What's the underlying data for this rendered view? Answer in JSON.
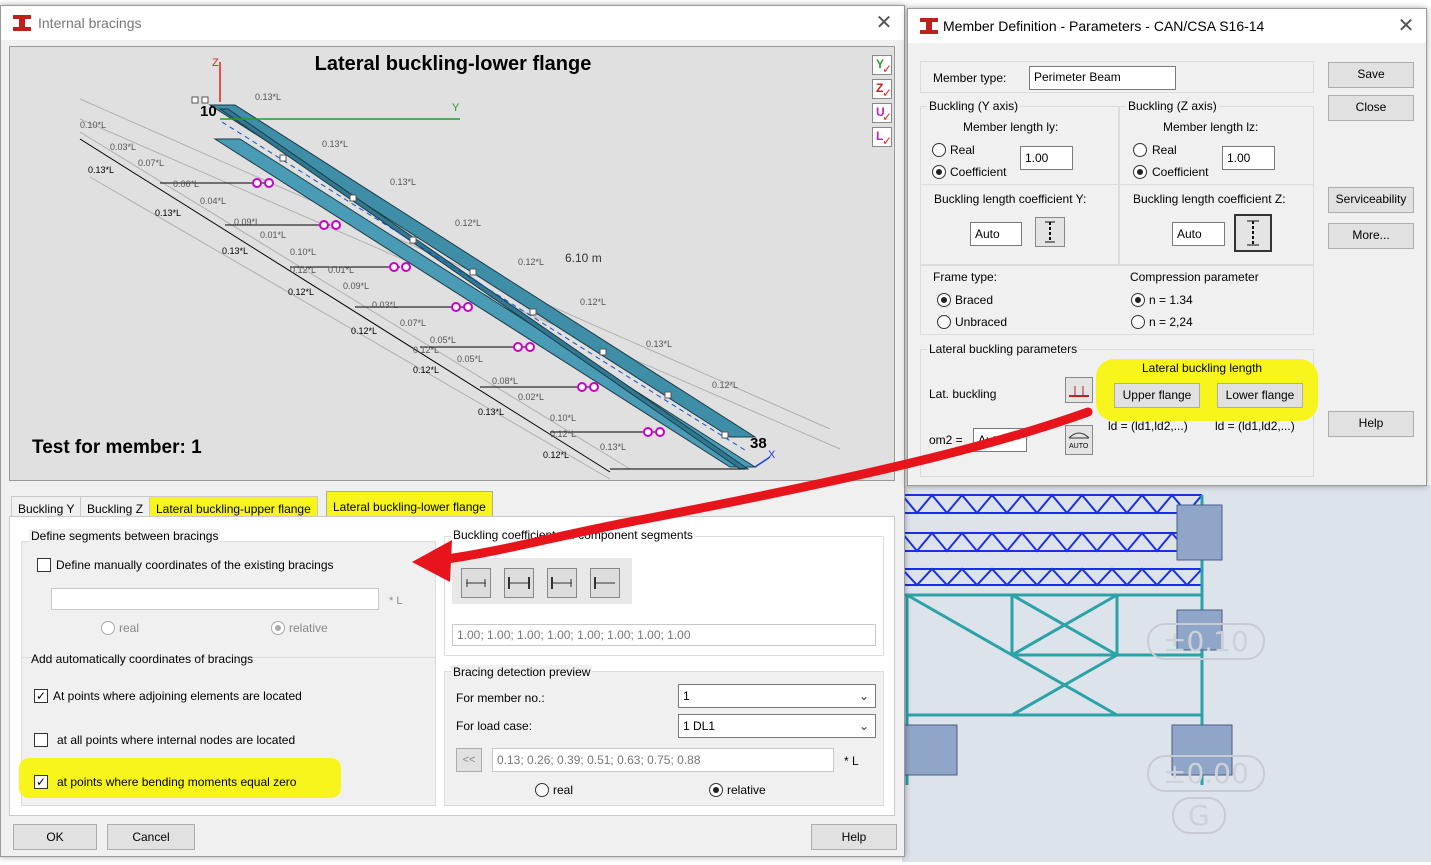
{
  "internal_bracings": {
    "title": "Internal bracings",
    "preview": {
      "title": "Lateral buckling-lower flange",
      "footer": "Test for member: 1",
      "span": "6.10  m",
      "node_start": "10",
      "node_end": "38",
      "axis_z": "Z",
      "axis_y": "Y",
      "axis_x": "X",
      "dim_labels": [
        "0.13*L",
        "0.10*L",
        "0.13*L",
        "0.03*L",
        "0.07*L",
        "0.13*L",
        "0.06*L",
        "0.13*L",
        "0.04*L",
        "0.13*L",
        "0.09*L",
        "0.12*L",
        "0.01*L",
        "0.13*L",
        "0.10*L",
        "0.12*L",
        "0.12*L",
        "0.01*L",
        "0.12*L",
        "0.09*L",
        "0.12*L",
        "0.03*L",
        "0.12*L",
        "0.07*L",
        "0.13*L",
        "0.05*L",
        "0.12*L",
        "0.05*L",
        "0.12*L",
        "0.08*L",
        "0.12*L",
        "0.02*L",
        "0.13*L",
        "0.10*L",
        "0.12*L",
        "0.13*L",
        "0.12*L"
      ],
      "side_icons": [
        "Y",
        "Z",
        "U",
        "L"
      ]
    },
    "tabs": [
      "Buckling Y",
      "Buckling Z",
      "Lateral buckling-upper flange",
      "Lateral buckling-lower flange"
    ],
    "define_segments": {
      "title": "Define segments between bracings",
      "manual_label": "Define manually coordinates of the existing bracings",
      "manual_checked": false,
      "unit": "* L",
      "real": "real",
      "relative": "relative"
    },
    "add_auto": {
      "title": "Add automatically coordinates of bracings",
      "opt1": "At points where adjoining elements are located",
      "opt1_checked": true,
      "opt2": "at all points where internal nodes are located",
      "opt2_checked": false,
      "opt3": "at points where bending moments equal zero",
      "opt3_checked": true
    },
    "buckling_coeff": {
      "title": "Buckling coefficients of component segments",
      "values": "1.00; 1.00; 1.00; 1.00; 1.00; 1.00; 1.00; 1.00"
    },
    "detection": {
      "title": "Bracing detection preview",
      "member_label": "For member no.:",
      "member_value": "1",
      "load_label": "For load case:",
      "load_value": "1  DL1",
      "back": "<<",
      "coords": "0.13; 0.26; 0.39; 0.51; 0.63; 0.75; 0.88",
      "unit": "* L",
      "real": "real",
      "relative": "relative"
    },
    "buttons": {
      "ok": "OK",
      "cancel": "Cancel",
      "help": "Help"
    }
  },
  "member_definition": {
    "title": "Member Definition - Parameters - CAN/CSA S16-14",
    "member_type_label": "Member type:",
    "member_type_value": "Perimeter Beam",
    "buckling_y": {
      "title": "Buckling (Y axis)",
      "length_label": "Member length ly:",
      "real": "Real",
      "coefficient": "Coefficient",
      "value": "1.00",
      "coeff_label": "Buckling length coefficient Y:",
      "auto": "Auto"
    },
    "buckling_z": {
      "title": "Buckling (Z axis)",
      "length_label": "Member length lz:",
      "real": "Real",
      "coefficient": "Coefficient",
      "value": "1.00",
      "coeff_label": "Buckling length coefficient Z:",
      "auto": "Auto"
    },
    "frame_type": {
      "title": "Frame type:",
      "braced": "Braced",
      "unbraced": "Unbraced"
    },
    "compression": {
      "title": "Compression parameter",
      "opt1": "n = 1.34",
      "opt2": "n = 2,24"
    },
    "lateral": {
      "title": "Lateral buckling parameters",
      "lat_label": "Lat. buckling",
      "length_title": "Lateral buckling length",
      "upper": "Upper flange",
      "lower": "Lower flange",
      "om2_label": "om2 =",
      "om2_value": "Auto",
      "ld_upper": "ld = (ld1,ld2,...)",
      "ld_lower": "ld = (ld1,ld2,...)",
      "auto_icon": "AUTO"
    },
    "buttons": {
      "save": "Save",
      "close": "Close",
      "serviceability": "Serviceability",
      "more": "More...",
      "help": "Help"
    }
  },
  "background": {
    "label1": "±0.10",
    "label2": "±0.00",
    "label3": "G"
  },
  "colors": {
    "highlight": "#f7f51c",
    "arrow": "#e8141c",
    "beam": "#3e8ea8",
    "bracing": "#cc00cc"
  }
}
